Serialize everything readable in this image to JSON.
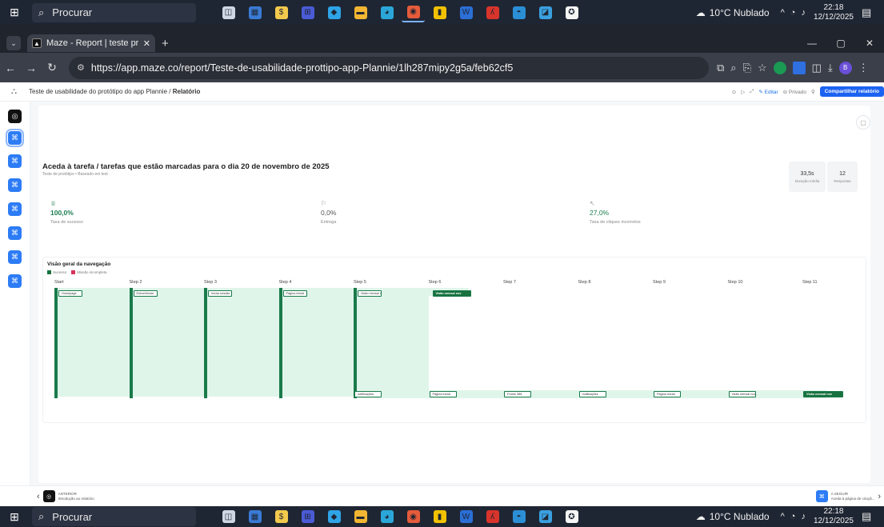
{
  "taskbar": {
    "search_placeholder": "Procurar",
    "weather": "10°C Nublado",
    "time": "22:18",
    "date": "12/12/2025",
    "app_icons": [
      "task-view-icon",
      "widgets-icon",
      "stripe-icon",
      "teams-icon",
      "store-icon",
      "file-explorer-icon",
      "edge-icon",
      "chrome-icon",
      "sticky-notes-icon",
      "word-icon",
      "acrobat-icon",
      "browser-icon",
      "photos-icon",
      "chatgpt-icon"
    ]
  },
  "browser": {
    "tab_title": "Maze - Report | teste prototipo",
    "url": "https://app.maze.co/report/Teste-de-usabilidade-prottipo-app-Plannie/1lh287mipy2g5a/feb62cf5",
    "profile_initial": "B"
  },
  "app": {
    "breadcrumb_project": "Teste de usabilidade do protótipo do app Plannie",
    "breadcrumb_sep": "/",
    "breadcrumb_current": "Relatório",
    "editar": "Editar",
    "privado": "Privado",
    "share_label": "Compartilhar relatório"
  },
  "task": {
    "title": "Aceda à tarefa / tarefas que estão marcadas para o dia 20 de novembro de 2025",
    "subtitle": "Teste de protótipo • Baseado em test",
    "avg_duration_value": "33,5s",
    "avg_duration_label": "Duração média",
    "responses_value": "12",
    "responses_label": "Respostas"
  },
  "metrics": [
    {
      "value": "100,0%",
      "label": "Taxa de sucesso",
      "icon": "trophy-icon"
    },
    {
      "value": "0,0%",
      "label": "Entrega",
      "icon": "give-up-icon"
    },
    {
      "value": "27,0%",
      "label": "Taxa de cliques incorretos",
      "icon": "misclick-icon"
    }
  ],
  "navigation": {
    "title": "Visão geral da navegação",
    "legend_success": "Sucesso",
    "legend_incomplete": "Missão incompleta",
    "success_color": "#17723f",
    "incomplete_color": "#d6335a",
    "steps": [
      "Start",
      "Step 2",
      "Step 3",
      "Step 4",
      "Step 5",
      "Step 6",
      "Step 7",
      "Step 8",
      "Step 9",
      "Step 10",
      "Step 11"
    ],
    "top_nodes": [
      "Homepage",
      "Entrar/Iniciar",
      "Iniciar sessão",
      "Página Inicial",
      "Visão mensal nov",
      "Visão mensal nov"
    ],
    "bottom_nodes": [
      "notificações",
      "Página Inicial",
      "Frame 388",
      "notificações",
      "Página Inicial",
      "Visão mensal nov",
      "Visão mensal nov"
    ]
  },
  "footer": {
    "prev_label": "ANTERIOR",
    "prev_title": "Introdução ao relatório",
    "next_label": "A SEGUIR",
    "next_title": "Aceda à página de criaçã..."
  }
}
